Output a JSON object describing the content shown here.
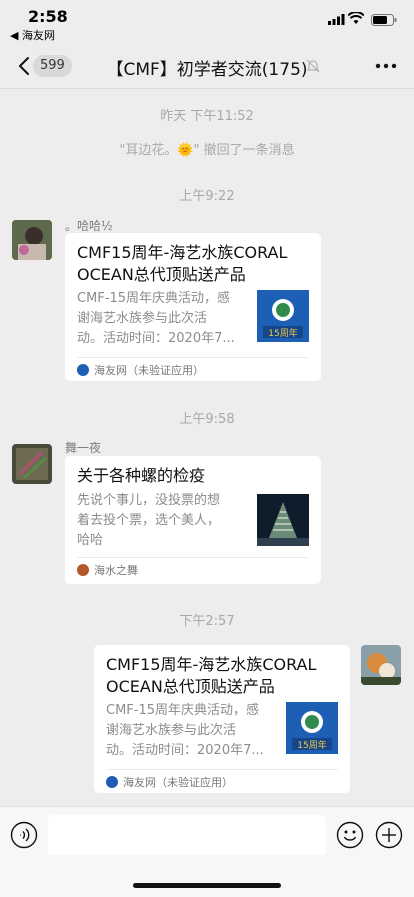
{
  "status": {
    "time": "2:58",
    "back_app": "◀ 海友网"
  },
  "nav": {
    "unread_count": "599",
    "title": "【CMF】初学者交流(175)"
  },
  "timeline": {
    "ts1": "昨天 下午11:52",
    "recall_notice": "\"耳边花。🌞\" 撤回了一条消息",
    "ts2": "上午9:22",
    "ts3": "上午9:58",
    "ts4": "下午2:57"
  },
  "messages": [
    {
      "sender": "。哈哈½",
      "title": "CMF15周年-海艺水族CORAL OCEAN总代顶贴送产品",
      "desc": "CMF-15周年庆典活动，感\n谢海艺水族参与此次活\n动。活动时间：2020年7...",
      "source": "海友网（未验证应用）",
      "thumb_text": "15周年"
    },
    {
      "sender": "舞一夜",
      "title": "关于各种螺的检疫",
      "desc": "先说个事儿，没投票的想\n着去投个票，选个美人，\n哈哈",
      "source": "海水之舞"
    },
    {
      "sender": "",
      "title": "CMF15周年-海艺水族CORAL OCEAN总代顶贴送产品",
      "desc": "CMF-15周年庆典活动，感\n谢海艺水族参与此次活\n动。活动时间：2020年7...",
      "source": "海友网（未验证应用）",
      "thumb_text": "15周年"
    }
  ],
  "input": {
    "value": "",
    "placeholder": ""
  },
  "colors": {
    "background": "#ededed",
    "bubble": "#ffffff",
    "meta_text": "#a8a8a8"
  }
}
